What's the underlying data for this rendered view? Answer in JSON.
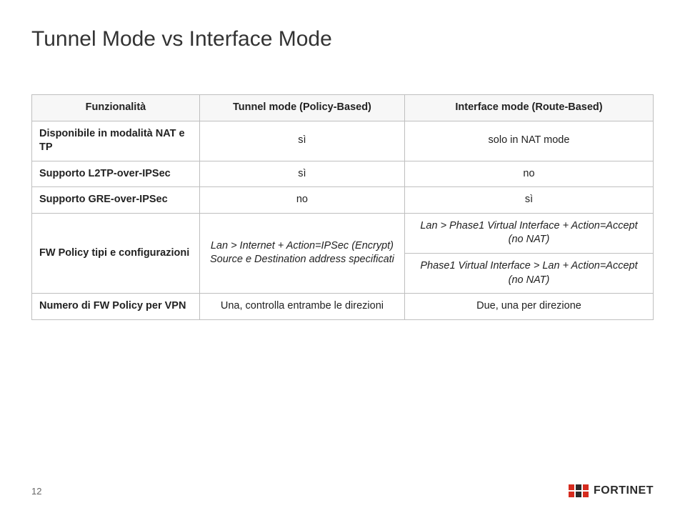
{
  "slide": {
    "title": "Tunnel Mode vs Interface Mode",
    "page_number": "12",
    "logo_text": "FORTINET"
  },
  "table": {
    "header": {
      "col0": "Funzionalità",
      "col1": "Tunnel mode (Policy-Based)",
      "col2": "Interface mode (Route-Based)"
    },
    "rows": [
      {
        "label": "Disponibile in modalità NAT e TP",
        "col1": "sì",
        "col2": "solo in NAT mode"
      },
      {
        "label": "Supporto L2TP-over-IPSec",
        "col1": "sì",
        "col2": "no"
      },
      {
        "label": "Supporto GRE-over-IPSec",
        "col1": "no",
        "col2": "sì"
      },
      {
        "label": "FW Policy tipi e configurazioni",
        "col1": "Lan > Internet + Action=IPSec (Encrypt)\nSource e Destination address specificati",
        "col2": "Lan > Phase1 Virtual Interface + Action=Accept (no NAT)"
      },
      {
        "label": "",
        "col1": "",
        "col2": "Phase1 Virtual Interface > Lan + Action=Accept (no NAT)"
      },
      {
        "label": "Numero di FW Policy per VPN",
        "col1": "Una, controlla entrambe le direzioni",
        "col2": "Due, una per direzione"
      }
    ]
  }
}
